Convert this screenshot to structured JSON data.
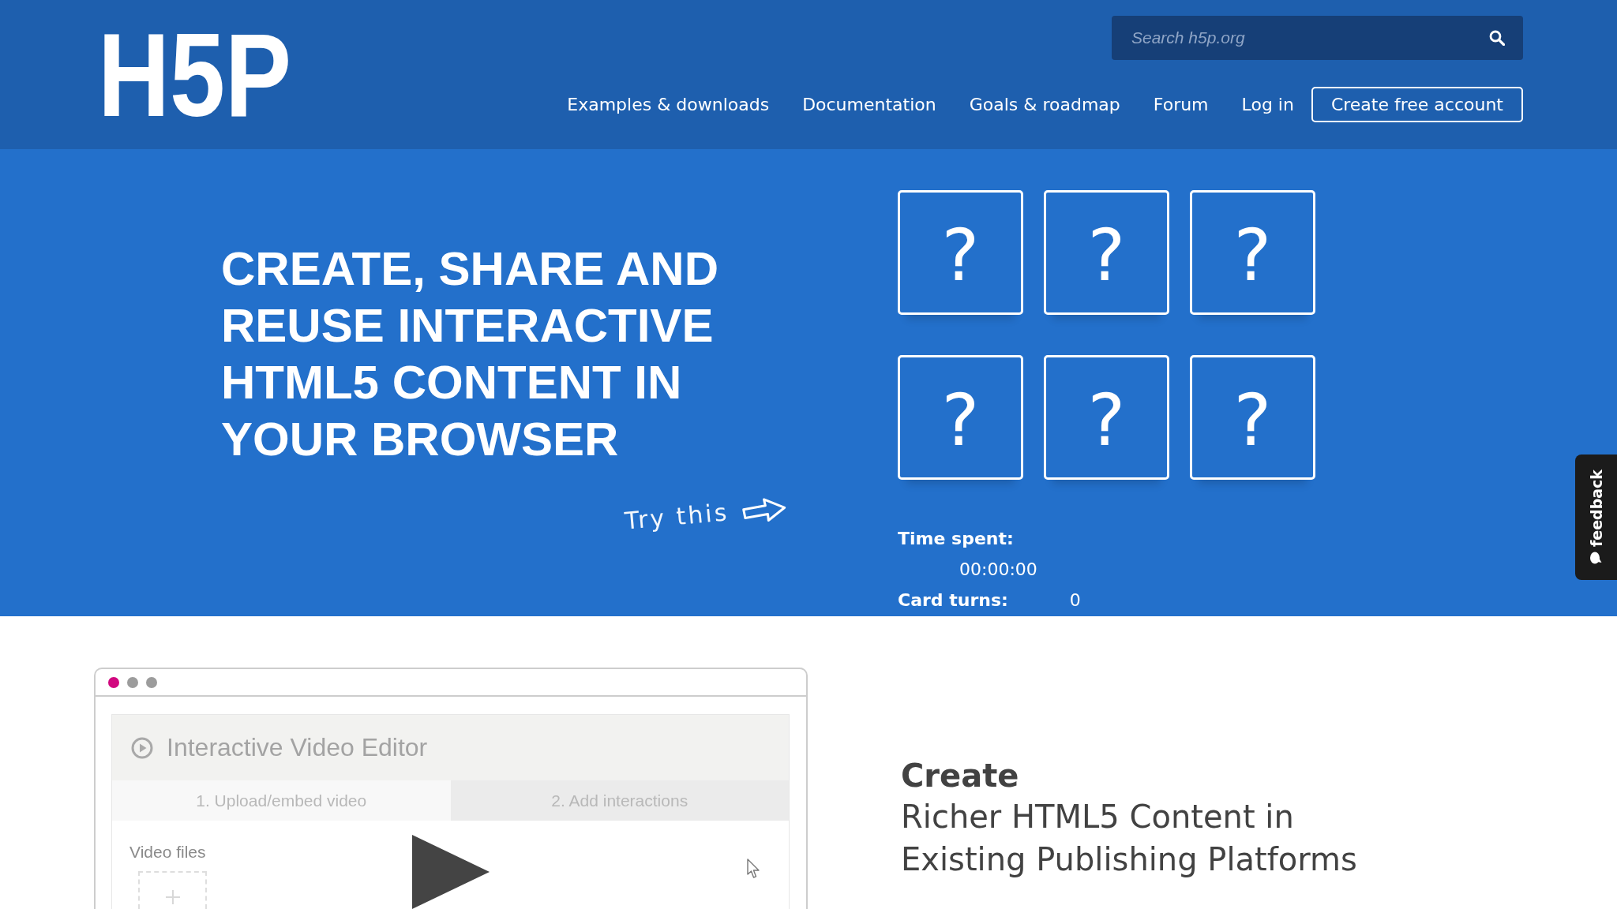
{
  "header": {
    "logo": "H5P",
    "search": {
      "placeholder": "Search h5p.org"
    },
    "nav": [
      {
        "label": "Examples & downloads",
        "kind": "link"
      },
      {
        "label": "Documentation",
        "kind": "link"
      },
      {
        "label": "Goals & roadmap",
        "kind": "link"
      },
      {
        "label": "Forum",
        "kind": "link"
      },
      {
        "label": "Log in",
        "kind": "link"
      },
      {
        "label": "Create free account",
        "kind": "button"
      }
    ]
  },
  "hero": {
    "headline": "CREATE, SHARE AND REUSE INTERACTIVE HTML5 CONTENT IN YOUR BROWSER",
    "hint": "Try this",
    "cards": [
      {
        "face": "?"
      },
      {
        "face": "?"
      },
      {
        "face": "?"
      },
      {
        "face": "?"
      },
      {
        "face": "?"
      },
      {
        "face": "?"
      }
    ],
    "stats": [
      {
        "label": "Time spent:",
        "value": "00:00:00"
      },
      {
        "label": "Card turns:",
        "value": "0"
      }
    ]
  },
  "feedback_tab": {
    "label": "feedback"
  },
  "feature": {
    "editor_window": {
      "title": "Interactive Video Editor",
      "tabs": [
        {
          "label": "1. Upload/embed video",
          "selected": true
        },
        {
          "label": "2. Add interactions",
          "selected": false
        }
      ],
      "field_label": "Video files"
    },
    "heading": "Create",
    "subheading": "Richer HTML5 Content in Existing Publishing Platforms"
  }
}
